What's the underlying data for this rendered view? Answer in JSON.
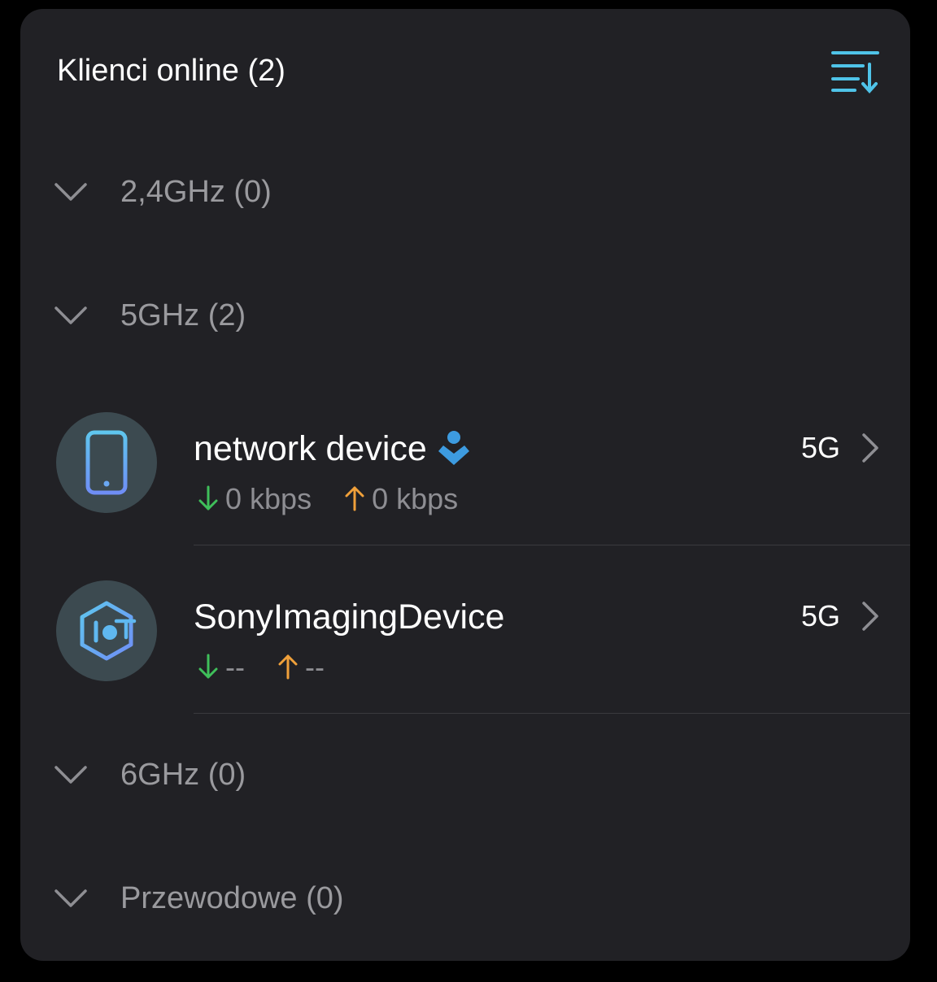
{
  "header": {
    "title": "Klienci online (2)",
    "sort_icon": "sort-descending-icon"
  },
  "groups": [
    {
      "label": "2,4GHz (0)",
      "icon": "chevron-down-icon"
    },
    {
      "label": "5GHz (2)",
      "icon": "chevron-down-icon"
    },
    {
      "label": "6GHz (0)",
      "icon": "chevron-down-icon"
    },
    {
      "label": "Przewodowe (0)",
      "icon": "chevron-down-icon"
    }
  ],
  "clients": [
    {
      "name": "network device",
      "device_icon": "smartphone-icon",
      "badge_icon": "parental-control-person-icon",
      "download": "0 kbps",
      "upload": "0 kbps",
      "band": "5G"
    },
    {
      "name": "SonyImagingDevice",
      "device_icon": "iot-device-icon",
      "download": "--",
      "upload": "--",
      "band": "5G"
    }
  ],
  "colors": {
    "card_background": "#212125",
    "accent": "#4fc3e8",
    "download_arrow": "#3fbf5a",
    "upload_arrow": "#f0a03a",
    "badge": "#3d9be0"
  }
}
